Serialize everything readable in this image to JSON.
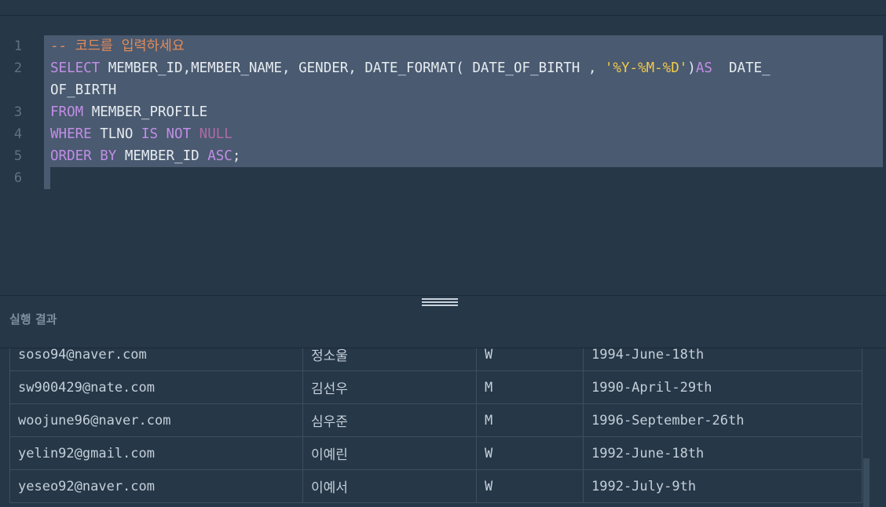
{
  "editor": {
    "line_numbers": [
      "1",
      "2",
      "",
      "3",
      "4",
      "5",
      "6"
    ],
    "lines": [
      [
        {
          "t": "-- 코드를 입력하세요",
          "c": "comment"
        }
      ],
      [
        {
          "t": "SELECT",
          "c": "kw"
        },
        {
          "t": " MEMBER_ID,MEMBER_NAME, GENDER, DATE_FORMAT( DATE_OF_BIRTH , ",
          "c": "plain"
        },
        {
          "t": "'%Y-%M-%D'",
          "c": "str"
        },
        {
          "t": ")",
          "c": "plain"
        },
        {
          "t": "AS",
          "c": "kw"
        },
        {
          "t": "  DATE_",
          "c": "plain"
        }
      ],
      [
        {
          "t": "OF_BIRTH",
          "c": "plain"
        }
      ],
      [
        {
          "t": "FROM",
          "c": "kw"
        },
        {
          "t": " MEMBER_PROFILE",
          "c": "plain"
        }
      ],
      [
        {
          "t": "WHERE",
          "c": "kw"
        },
        {
          "t": " TLNO ",
          "c": "plain"
        },
        {
          "t": "IS NOT",
          "c": "kw"
        },
        {
          "t": " ",
          "c": "plain"
        },
        {
          "t": "NULL",
          "c": "null"
        }
      ],
      [
        {
          "t": "ORDER BY",
          "c": "kw"
        },
        {
          "t": " MEMBER_ID ",
          "c": "plain"
        },
        {
          "t": "ASC",
          "c": "kw"
        },
        {
          "t": ";",
          "c": "plain"
        }
      ],
      []
    ]
  },
  "results": {
    "title": "실행 결과",
    "rows": [
      [
        "soso94@naver.com",
        "정소울",
        "W",
        "1994-June-18th"
      ],
      [
        "sw900429@nate.com",
        "김선우",
        "M",
        "1990-April-29th"
      ],
      [
        "woojune96@naver.com",
        "심우준",
        "M",
        "1996-September-26th"
      ],
      [
        "yelin92@gmail.com",
        "이예린",
        "W",
        "1992-June-18th"
      ],
      [
        "yeseo92@naver.com",
        "이예서",
        "W",
        "1992-July-9th"
      ]
    ]
  },
  "colors": {
    "background": "#263747",
    "selection": "#4a5a70",
    "comment": "#e08b5b",
    "keyword": "#c18ee6",
    "string": "#f2c94c"
  }
}
